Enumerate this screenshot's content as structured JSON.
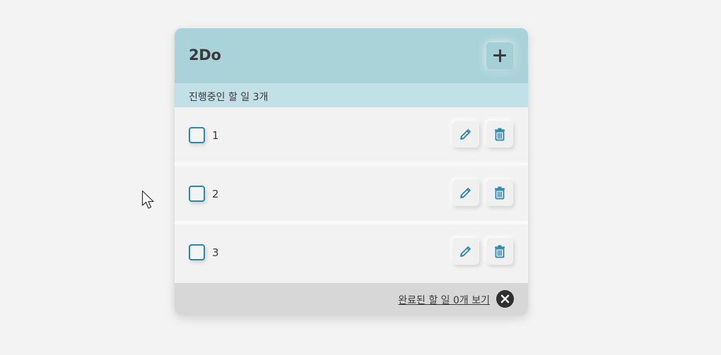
{
  "app": {
    "title": "2Do",
    "add_icon": "plus-icon"
  },
  "subheader": {
    "count_text": "진행중인 할 일 3개"
  },
  "todos": [
    {
      "text": "1",
      "checked": false
    },
    {
      "text": "2",
      "checked": false
    },
    {
      "text": "3",
      "checked": false
    }
  ],
  "icons": {
    "edit": "pencil-icon",
    "delete": "trash-icon",
    "close": "close-icon"
  },
  "footer": {
    "completed_link": "완료된 할 일 0개 보기"
  },
  "colors": {
    "header_bg": "#aad3d9",
    "subheader_bg": "#c2e1e6",
    "accent": "#2c87ab",
    "footer_bg": "#d7d7d7"
  }
}
